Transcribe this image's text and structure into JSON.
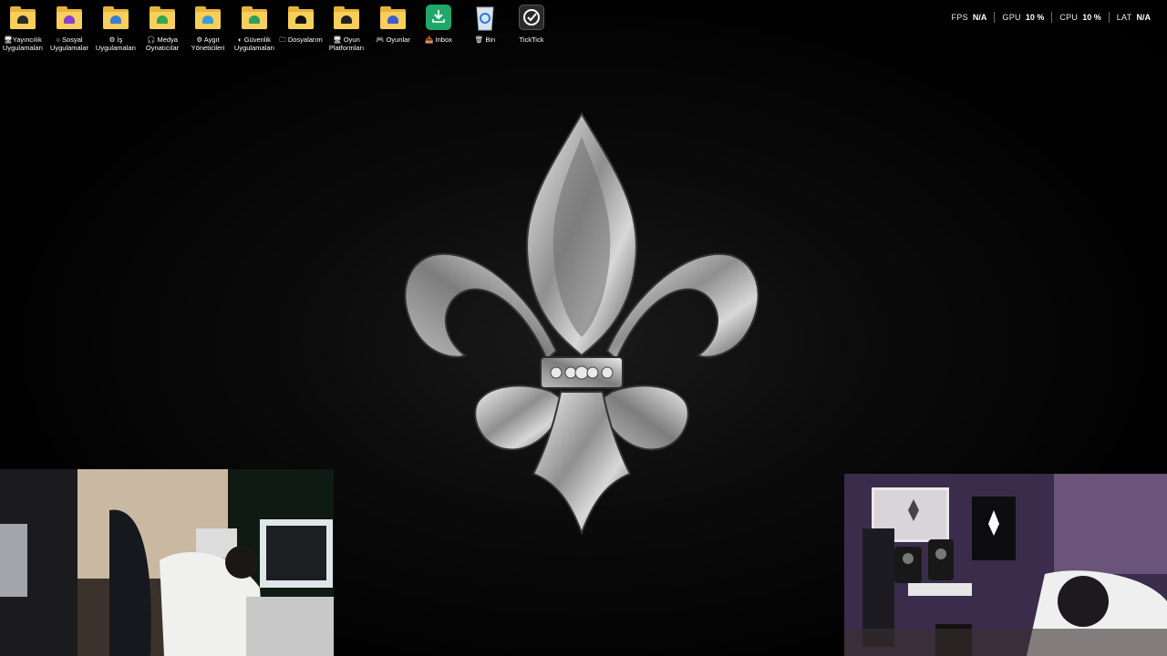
{
  "desktop": {
    "icons": [
      {
        "label": "🖥Yayıncılık Uygulamaları",
        "type": "folder",
        "emblem_color": "#2b2b2b"
      },
      {
        "label": "○ Sosyal Uygulamalar",
        "type": "folder",
        "emblem_color": "#8a3fd1"
      },
      {
        "label": "⚙ İş Uygulamaları",
        "type": "folder",
        "emblem_color": "#3a7bd5"
      },
      {
        "label": "🎧 Medya Oynatıcılar",
        "type": "folder",
        "emblem_color": "#2fa84f"
      },
      {
        "label": "⚙ Aygıt Yöneticileri",
        "type": "folder",
        "emblem_color": "#3a9ad9"
      },
      {
        "label": "◐ Güvenlik Uygulamaları",
        "type": "folder",
        "emblem_color": "#2e9e5b"
      },
      {
        "label": "🗀 Dosyalarım",
        "type": "folder",
        "emblem_color": "#111111"
      },
      {
        "label": "🖥 Oyun Platformları",
        "type": "folder",
        "emblem_color": "#222222"
      },
      {
        "label": "🎮 Oyunlar",
        "type": "folder",
        "emblem_color": "#3d5bd1"
      },
      {
        "label": "📥 Inbox",
        "type": "app",
        "tile_color": "#1fa86a"
      },
      {
        "label": "🗑 Bin",
        "type": "recycle-bin",
        "tile_color": "#d9e4ee"
      },
      {
        "label": "TickTick",
        "type": "app",
        "tile_color": "#2a2a2a"
      }
    ]
  },
  "overlay": {
    "stats": [
      {
        "key": "FPS",
        "value": "N/A"
      },
      {
        "key": "GPU",
        "value": "10 %"
      },
      {
        "key": "CPU",
        "value": "10 %"
      },
      {
        "key": "LAT",
        "value": "N/A"
      }
    ]
  },
  "colors": {
    "folder": "#f7cf5a",
    "folder_back": "#e6b43a",
    "background": "#000000",
    "emblem_silver": "#c9c9c9"
  }
}
